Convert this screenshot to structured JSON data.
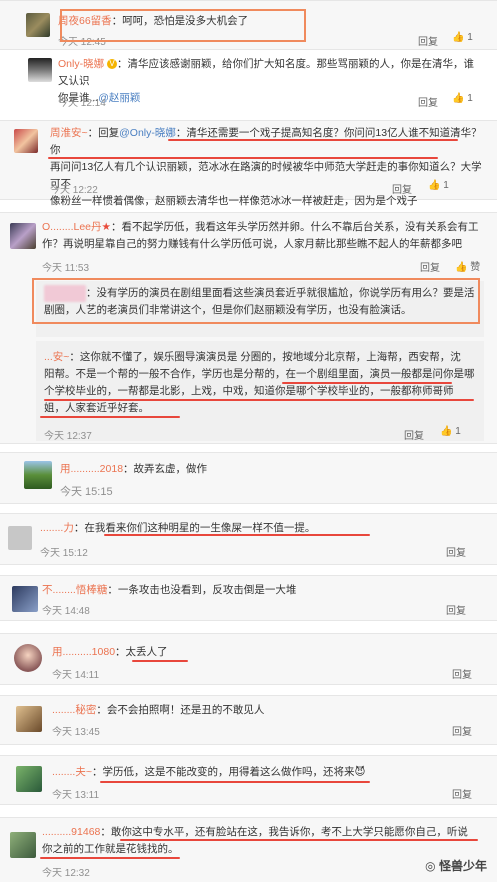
{
  "c1": {
    "name": "周夜66留香",
    "text": "：呵呵，恐怕是没多大机会了",
    "time": "今天 12:45",
    "reply": "回复",
    "likes": "1"
  },
  "c2": {
    "name": "Only-晓娜",
    "vbadge": "V",
    "text1": "：清华应该感谢丽颖，给你们扩大知名度。那些骂丽颖的人，你是在清华，谁又认识",
    "text2": "你是谁...",
    "mention": "@赵丽颖",
    "time": "今天 12:14",
    "reply": "回复",
    "likes": "1"
  },
  "c3": {
    "name": "周淮安~",
    "reply_prefix": "：回复",
    "mention": "@Only-晓娜",
    "text1": "：清华还需要一个戏子提高知名度？你问问13亿人谁不知道清华？你",
    "text2": "再问问13亿人有几个认识丽颖，范冰冰在路演的时候被华中师范大学赶走的事你知道么？大学可不",
    "text3": "像粉丝一样惯着偶像，赵丽颖去清华也一样像范冰冰一样被赶走，因为是个戏子",
    "time": "今天 12:22",
    "reply": "回复",
    "likes": "1"
  },
  "c4": {
    "name": "O........Lee丹",
    "text1": "：看不起学历低，我看这年头学历然并卵。什么不靠后台关系，没有关系会有工",
    "text2": "作？再说明星靠自己的努力赚钱有什么学历低可说，人家月薪比那些瞧不起人的年薪都多吧",
    "time": "今天 11:53",
    "reply": "回复",
    "like_label": "赞",
    "sub1": {
      "text1": "：没有学历的演员在剧组里面看这些演员套近乎就很尴尬，你说学历有用么？要是活",
      "text2": "剧圈，人艺的老演员们非常讲这个，但是你们赵丽颖没有学历，也没有脸演话。"
    },
    "sub2": {
      "name": "...安~",
      "text1": "：这你就不懂了，娱乐圈导演演员是 分圈的，按地域分北京帮，上海帮，西安帮，沈",
      "text2": "阳帮。不是一个帮的一般不合作，学历也是分帮的，在一个剧组里面，演员一般都是问你是哪",
      "text3": "个学校毕业的，一帮都是北影，上戏，中戏，知道你是哪个学校毕业的，一般都称师哥师",
      "text4": "姐，人家套近乎好套。",
      "time": "今天 12:37",
      "reply": "回复",
      "likes": "1"
    }
  },
  "c5": {
    "name": "用..........2018",
    "text": "：故弄玄虚，做作",
    "time": "今天 15:15"
  },
  "c6": {
    "name": "........力",
    "text": "：在我看来你们这种明星的一生像屎一样不值一提。",
    "time": "今天 15:12",
    "reply": "回复"
  },
  "c7": {
    "name": "不........悟棒糖",
    "text": "：一条攻击也没看到，反攻击倒是一大堆",
    "time": "今天 14:48",
    "reply": "回复"
  },
  "c8": {
    "name": "用..........1080",
    "text": "：太丢人了",
    "time": "今天 14:11",
    "reply": "回复"
  },
  "c9": {
    "name": "........秘密",
    "text": "：会不会拍照啊！还是丑的不敢见人",
    "time": "今天 13:45",
    "reply": "回复"
  },
  "c10": {
    "name": "........夫~",
    "text": "：学历低，这是不能改变的，用得着这么做作吗，还将来",
    "emoji": "😈",
    "time": "今天 13:11",
    "reply": "回复"
  },
  "c11": {
    "name": "..........91468",
    "text1": "：敢你这中专水平，还有脸站在这，我告诉你，考不上大学只能愿你自己，听说",
    "text2": "你之前的工作就是花钱找的。",
    "time": "今天 12:32"
  },
  "watermark": "怪兽少年",
  "colors": {
    "name": "#eb7350",
    "link": "#4a7fc1",
    "underline": "#e8473c",
    "box": "#f08a5d"
  }
}
